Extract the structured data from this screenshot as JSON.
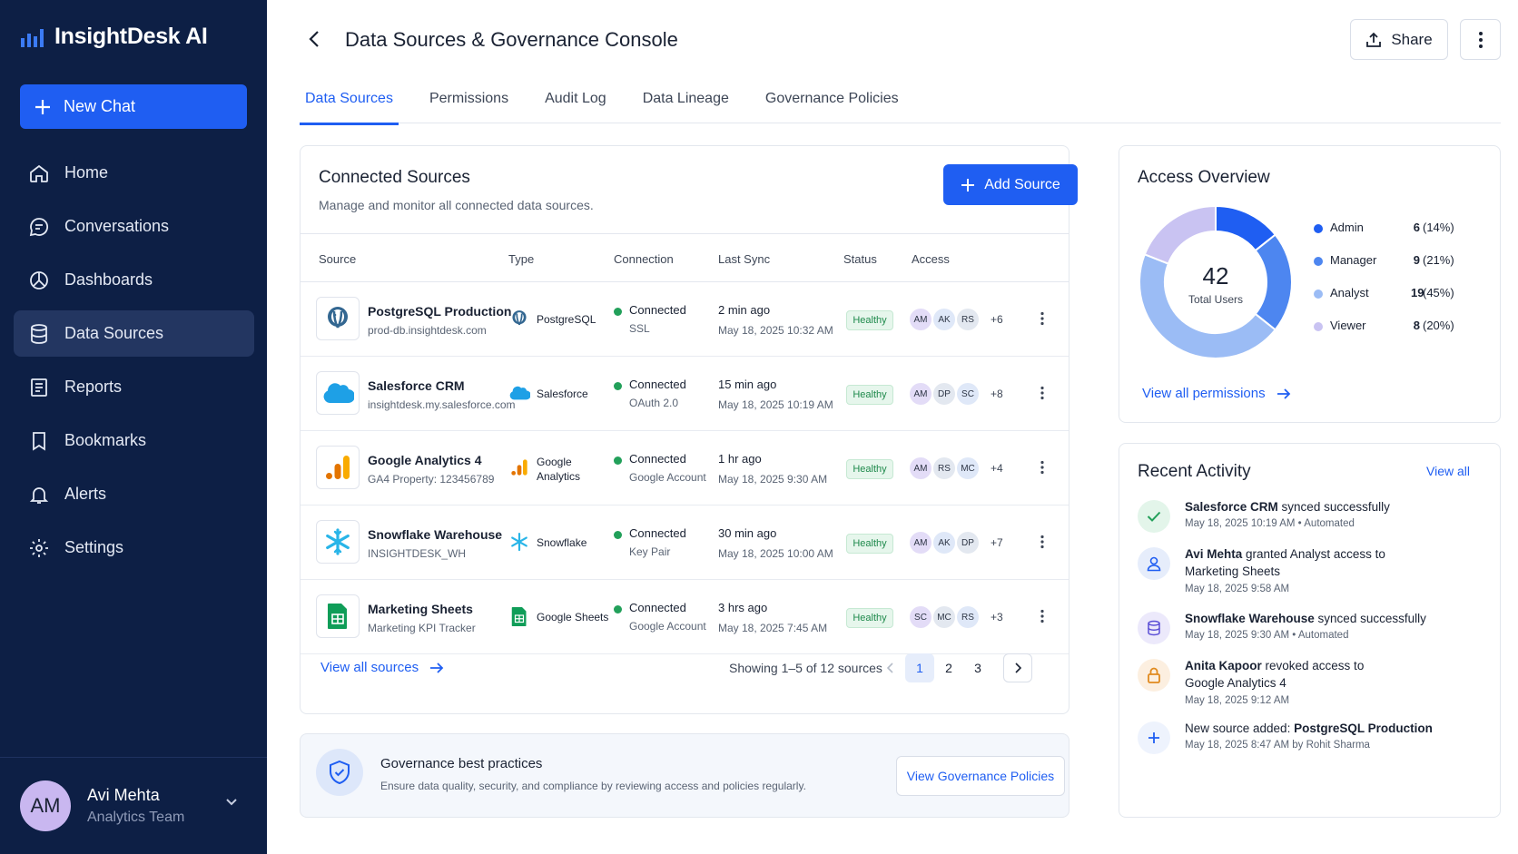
{
  "app": {
    "name": "InsightDesk AI",
    "new_chat": "New Chat"
  },
  "nav": [
    {
      "label": "Home",
      "icon": "home-icon"
    },
    {
      "label": "Conversations",
      "icon": "chat-icon"
    },
    {
      "label": "Dashboards",
      "icon": "dashboard-icon"
    },
    {
      "label": "Data Sources",
      "icon": "database-icon",
      "active": true
    },
    {
      "label": "Reports",
      "icon": "report-icon"
    },
    {
      "label": "Bookmarks",
      "icon": "bookmark-icon"
    },
    {
      "label": "Alerts",
      "icon": "bell-icon"
    },
    {
      "label": "Settings",
      "icon": "gear-icon"
    }
  ],
  "user": {
    "initials": "AM",
    "name": "Avi Mehta",
    "team": "Analytics Team"
  },
  "header": {
    "title": "Data Sources & Governance Console",
    "share": "Share"
  },
  "tabs": [
    "Data Sources",
    "Permissions",
    "Audit Log",
    "Data Lineage",
    "Governance Policies"
  ],
  "sources": {
    "title": "Connected Sources",
    "subtitle": "Manage and monitor all connected data sources.",
    "add_button": "Add Source",
    "columns": [
      "Source",
      "Type",
      "Connection",
      "Last Sync",
      "Status",
      "Access"
    ],
    "rows": [
      {
        "name": "PostgreSQL Production",
        "sub": "prod-db.insightdesk.com",
        "type": "PostgreSQL",
        "conn": "Connected",
        "conn_sub": "SSL",
        "sync": "2 min ago",
        "sync_sub": "May 18, 2025 10:32 AM",
        "status": "Healthy",
        "access": [
          "AM",
          "AK",
          "RS"
        ],
        "more": "+6"
      },
      {
        "name": "Salesforce CRM",
        "sub": "insightdesk.my.salesforce.com",
        "type": "Salesforce",
        "conn": "Connected",
        "conn_sub": "OAuth 2.0",
        "sync": "15 min ago",
        "sync_sub": "May 18, 2025 10:19 AM",
        "status": "Healthy",
        "access": [
          "AM",
          "DP",
          "SC"
        ],
        "more": "+8"
      },
      {
        "name": "Google Analytics 4",
        "sub": "GA4 Property: 123456789",
        "type": "Google Analytics",
        "conn": "Connected",
        "conn_sub": "Google Account",
        "sync": "1 hr ago",
        "sync_sub": "May 18, 2025 9:30 AM",
        "status": "Healthy",
        "access": [
          "AM",
          "RS",
          "MC"
        ],
        "more": "+4"
      },
      {
        "name": "Snowflake Warehouse",
        "sub": "INSIGHTDESK_WH",
        "type": "Snowflake",
        "conn": "Connected",
        "conn_sub": "Key Pair",
        "sync": "30 min ago",
        "sync_sub": "May 18, 2025 10:00 AM",
        "status": "Healthy",
        "access": [
          "AM",
          "AK",
          "DP"
        ],
        "more": "+7"
      },
      {
        "name": "Marketing Sheets",
        "sub": "Marketing KPI Tracker",
        "type": "Google Sheets",
        "conn": "Connected",
        "conn_sub": "Google Account",
        "sync": "3 hrs ago",
        "sync_sub": "May 18, 2025 7:45 AM",
        "status": "Healthy",
        "access": [
          "SC",
          "MC",
          "RS"
        ],
        "more": "+3"
      }
    ],
    "view_all": "View all sources",
    "showing": "Showing 1–5 of 12 sources",
    "pages": [
      "1",
      "2",
      "3"
    ]
  },
  "governance": {
    "title": "Governance best practices",
    "subtitle": "Ensure data quality, security, and compliance by reviewing access and policies regularly.",
    "button": "View Governance Policies"
  },
  "access": {
    "title": "Access Overview",
    "total": "42",
    "total_label": "Total Users",
    "legend": [
      {
        "label": "Admin",
        "count": "6",
        "pct": "(14%)",
        "color": "#1f5ef2",
        "value": 6
      },
      {
        "label": "Manager",
        "count": "9",
        "pct": "(21%)",
        "color": "#4d86f0",
        "value": 9
      },
      {
        "label": "Analyst",
        "count": "19",
        "pct": "(45%)",
        "color": "#9bbcf5",
        "value": 19
      },
      {
        "label": "Viewer",
        "count": "8",
        "pct": "(20%)",
        "color": "#c9c3f2",
        "value": 8
      }
    ],
    "link": "View all permissions"
  },
  "activity": {
    "title": "Recent Activity",
    "view_all": "View all",
    "items": [
      {
        "strong": "Salesforce CRM",
        "text": " synced successfully",
        "meta": "May 18, 2025 10:19 AM  •  Automated"
      },
      {
        "strong": "Avi Mehta",
        "text": " granted Analyst access to Marketing Sheets",
        "meta": "May 18, 2025 9:58 AM"
      },
      {
        "strong": "Snowflake Warehouse",
        "text": " synced successfully",
        "meta": "May 18, 2025 9:30 AM  •  Automated"
      },
      {
        "strong": "Anita Kapoor",
        "text": " revoked access to Google Analytics 4",
        "meta": "May 18, 2025 9:12 AM"
      },
      {
        "pre": "New source added: ",
        "strong": "PostgreSQL Production",
        "text": "",
        "meta": "May 18, 2025 8:47 AM by Rohit Sharma"
      }
    ]
  }
}
